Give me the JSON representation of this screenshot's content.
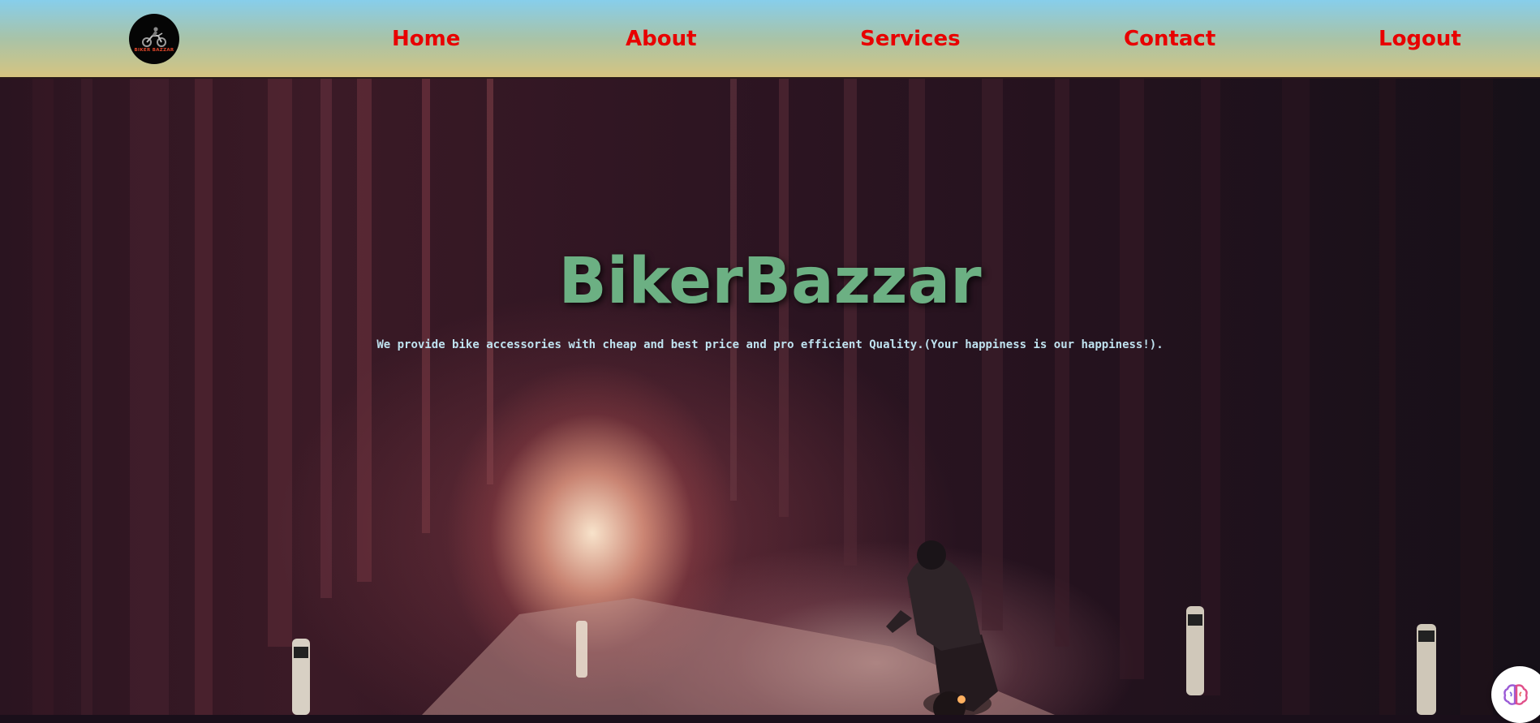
{
  "header": {
    "logo": {
      "text": "BIKER BAZZAR",
      "icon": "motorcycle-rider-icon"
    },
    "nav": [
      {
        "label": "Home"
      },
      {
        "label": "About"
      },
      {
        "label": "Services"
      },
      {
        "label": "Contact"
      },
      {
        "label": "Logout"
      }
    ],
    "link_color": "#e80000"
  },
  "hero": {
    "title": "BikerBazzar",
    "tagline": "We provide bike accessories with cheap and best price and pro efficient Quality.(Your happiness is our happiness!).",
    "title_color": "#6cb083",
    "tagline_color": "#bfe2ef",
    "background_icon": "forest-road-motorcycle-image"
  },
  "widget": {
    "icon": "brain-assistant-icon"
  }
}
